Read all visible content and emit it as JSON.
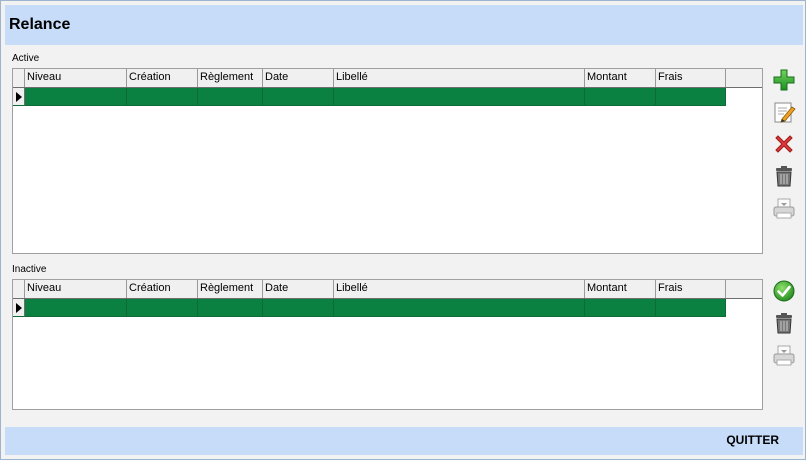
{
  "window": {
    "title": "Relance"
  },
  "active": {
    "label": "Active",
    "columns": [
      "Niveau",
      "Création",
      "Règlement",
      "Date",
      "Libellé",
      "Montant",
      "Frais"
    ],
    "row_color": "#0a8041"
  },
  "inactive": {
    "label": "Inactive",
    "columns": [
      "Niveau",
      "Création",
      "Règlement",
      "Date",
      "Libellé",
      "Montant",
      "Frais"
    ],
    "row_color": "#0a8041"
  },
  "toolbar_active": [
    "add-icon",
    "edit-icon",
    "delete-icon",
    "trash-icon",
    "print-icon"
  ],
  "toolbar_inactive": [
    "check-icon",
    "trash-icon",
    "print-icon"
  ],
  "footer": {
    "quit_label": "QUITTER"
  },
  "colors": {
    "title_bar": "#c6dcf8",
    "selected_row": "#0a8041",
    "background": "#f2f2f2"
  }
}
